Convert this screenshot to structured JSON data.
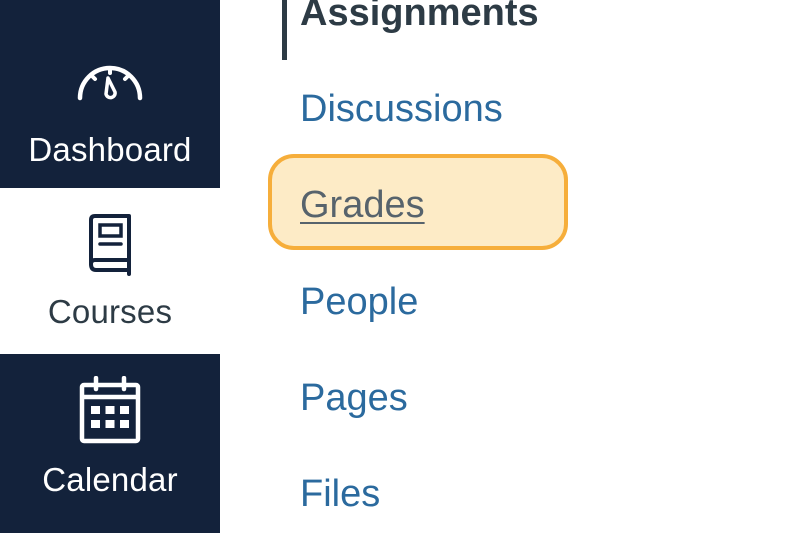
{
  "global_nav": {
    "items": [
      {
        "label": "Dashboard",
        "icon": "dashboard-icon"
      },
      {
        "label": "Courses",
        "icon": "courses-icon"
      },
      {
        "label": "Calendar",
        "icon": "calendar-icon"
      }
    ]
  },
  "course_nav": {
    "items": [
      {
        "label": "Assignments",
        "state": "active"
      },
      {
        "label": "Discussions"
      },
      {
        "label": "Grades",
        "state": "focused"
      },
      {
        "label": "People"
      },
      {
        "label": "Pages"
      },
      {
        "label": "Files"
      }
    ]
  },
  "colors": {
    "nav_background": "#13223b",
    "link": "#2b6a9e",
    "focus_border": "#f6ae3b",
    "focus_fill": "#fdebc6"
  }
}
